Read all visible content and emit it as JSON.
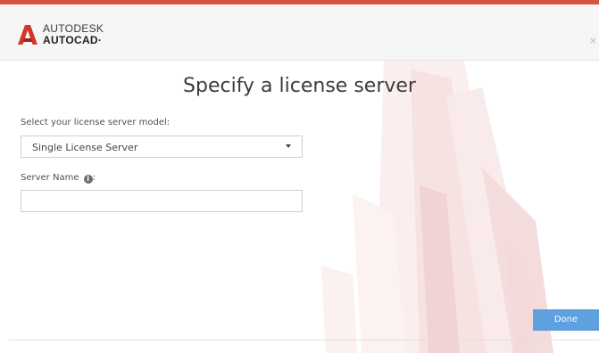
{
  "header": {
    "brand_line1": "AUTODESK",
    "brand_line2": "AUTOCAD",
    "brand_mark_suffix": "·",
    "close_label": "×",
    "accent_color": "#d6533e",
    "logo_icon": "autocad-a-logo-icon"
  },
  "main": {
    "title": "Specify a license server",
    "model_label": "Select your license server model:",
    "model_select": {
      "value": "Single License Server"
    },
    "server_name_label": "Server Name",
    "server_name_colon": ":",
    "info_glyph": "i",
    "server_name_input": {
      "value": "",
      "placeholder": ""
    }
  },
  "footer": {
    "done_label": "Done",
    "done_color": "#5ea1de"
  }
}
